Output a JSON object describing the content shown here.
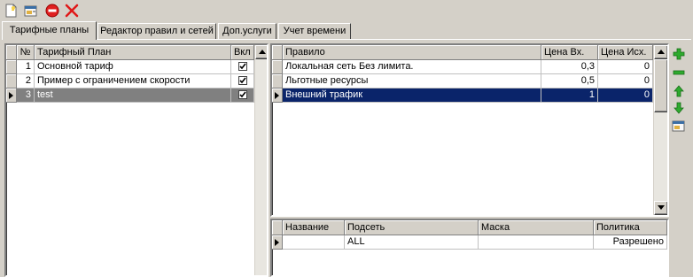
{
  "toolbar": {
    "items": [
      {
        "icon": "new-document-icon"
      },
      {
        "icon": "properties-icon"
      },
      {
        "icon": "stop-icon"
      },
      {
        "icon": "delete-icon"
      }
    ]
  },
  "tabs": [
    "Тарифные планы",
    "Редактор правил и сетей",
    "Доп.услуги",
    "Учет времени"
  ],
  "plans": {
    "columns": [
      "№",
      "Тарифный План",
      "Вкл"
    ],
    "rows": [
      {
        "num": "1",
        "name": "Основной тариф",
        "enabled": true
      },
      {
        "num": "2",
        "name": "Пример с ограничением скорости",
        "enabled": true
      },
      {
        "num": "3",
        "name": "test",
        "enabled": true
      }
    ]
  },
  "rules": {
    "columns": [
      "Правило",
      "Цена Вх.",
      "Цена Исх."
    ],
    "rows": [
      {
        "name": "Локальная сеть  Без лимита.",
        "in": "0,3",
        "out": "0"
      },
      {
        "name": "Льготные ресурсы",
        "in": "0,5",
        "out": "0"
      },
      {
        "name": "Внешний трафик",
        "in": "1",
        "out": "0"
      }
    ]
  },
  "networks": {
    "columns": [
      "Название",
      "Подсеть",
      "Маска",
      "Политика"
    ],
    "rows": [
      {
        "name": "",
        "subnet": "ALL",
        "mask": "",
        "policy": "Разрешено"
      }
    ]
  },
  "side_buttons": [
    "add-icon",
    "remove-icon",
    "move-up-icon",
    "move-down-icon",
    "properties-icon"
  ],
  "colors": {
    "selection": "#0a246a",
    "inactive_selection": "#808080",
    "face": "#d4d0c8"
  }
}
